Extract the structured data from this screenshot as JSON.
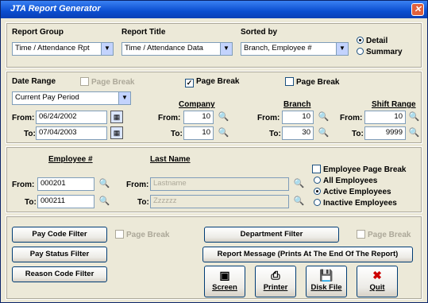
{
  "window": {
    "title": "JTA Report Generator",
    "close_glyph": "✕"
  },
  "top": {
    "report_group_label": "Report Group",
    "report_group_value": "Time / Attendance Rpt",
    "report_title_label": "Report Title",
    "report_title_value": "Time / Attendance Data",
    "sorted_by_label": "Sorted by",
    "sorted_by_value": "Branch, Employee #",
    "detail_label": "Detail",
    "summary_label": "Summary"
  },
  "date": {
    "label": "Date Range",
    "page_break_label": "Page Break",
    "range_value": "Current Pay Period",
    "from_label": "From:",
    "from_value": "06/24/2002",
    "to_label": "To:",
    "to_value": "07/04/2003"
  },
  "company": {
    "header": "Company",
    "page_break_label": "Page Break",
    "from_label": "From:",
    "from_value": "10",
    "to_label": "To:",
    "to_value": "10"
  },
  "branch": {
    "header": "Branch",
    "page_break_label": "Page Break",
    "from_label": "From:",
    "from_value": "10",
    "to_label": "To:",
    "to_value": "30"
  },
  "shift": {
    "header": "Shift Range",
    "from_label": "From:",
    "from_value": "10",
    "to_label": "To:",
    "to_value": "9999"
  },
  "employee": {
    "header": "Employee #",
    "from_label": "From:",
    "from_value": "000201",
    "to_label": "To:",
    "to_value": "000211"
  },
  "last_name": {
    "header": "Last Name",
    "from_label": "From:",
    "from_value": "Lastname",
    "to_label": "To:",
    "to_value": "Zzzzzz"
  },
  "options": {
    "emp_page_break_label": "Employee Page Break",
    "all_label": "All Employees",
    "active_label": "Active Employees",
    "inactive_label": "Inactive Employees"
  },
  "bottom": {
    "pay_code_filter": "Pay Code Filter",
    "pay_code_page_break": "Page Break",
    "department_filter": "Department Filter",
    "dept_page_break": "Page Break",
    "pay_status_filter": "Pay Status Filter",
    "report_message": "Report Message (Prints At The End Of The Report)",
    "reason_code_filter": "Reason Code Filter",
    "screen_label": "Screen",
    "printer_label": "Printer",
    "disk_file_label": "Disk File",
    "quit_label": "Quit"
  },
  "icons": {
    "lookup": "🔍",
    "calendar": "▦",
    "dropdown": "▼",
    "check": "✓",
    "screen": "▣",
    "printer": "⎙",
    "disk": "💾",
    "quit": "✖"
  },
  "colors": {
    "titlebar": "#0b4ed0",
    "quit_icon": "#cc0000"
  }
}
